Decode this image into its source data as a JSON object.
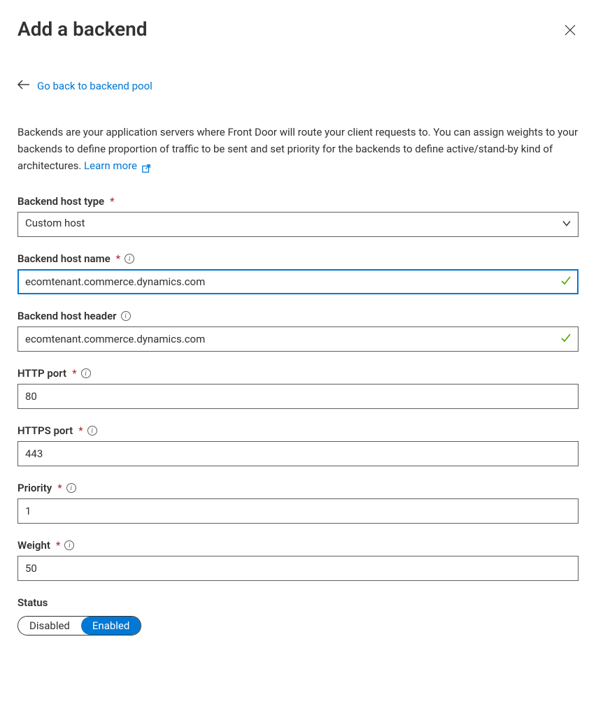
{
  "title": "Add a backend",
  "back_link_text": "Go back to backend pool",
  "description": "Backends are your application servers where Front Door will route your client requests to. You can assign weights to your backends to define proportion of traffic to be sent and set priority for the backends to define active/stand-by kind of architectures. ",
  "learn_more": "Learn more",
  "fields": {
    "host_type": {
      "label": "Backend host type",
      "value": "Custom host"
    },
    "host_name": {
      "label": "Backend host name",
      "value": "ecomtenant.commerce.dynamics.com"
    },
    "host_header": {
      "label": "Backend host header",
      "value": "ecomtenant.commerce.dynamics.com"
    },
    "http_port": {
      "label": "HTTP port",
      "value": "80"
    },
    "https_port": {
      "label": "HTTPS port",
      "value": "443"
    },
    "priority": {
      "label": "Priority",
      "value": "1"
    },
    "weight": {
      "label": "Weight",
      "value": "50"
    },
    "status": {
      "label": "Status",
      "disabled": "Disabled",
      "enabled": "Enabled"
    }
  }
}
